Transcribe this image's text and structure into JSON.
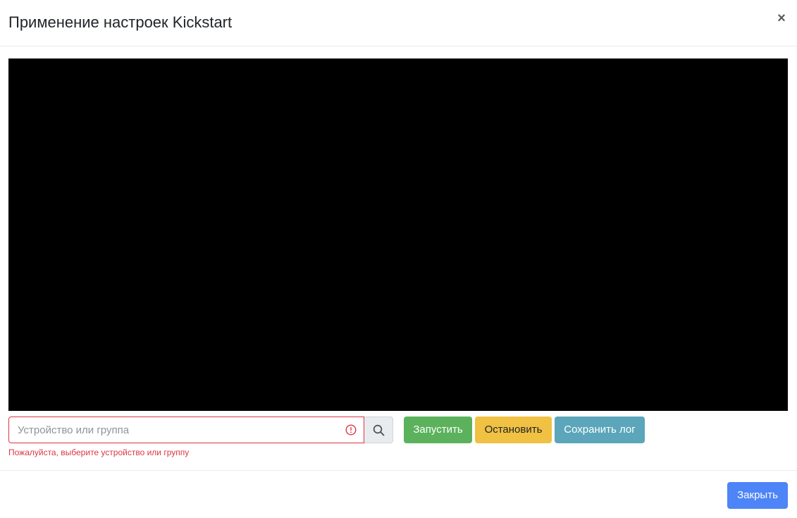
{
  "modal": {
    "title": "Применение настроек Kickstart",
    "close_icon": "×"
  },
  "terminal": {
    "background": "#000000"
  },
  "controls": {
    "device_input": {
      "value": "",
      "placeholder": "Устройство или группа",
      "error_icon": "exclamation-circle-icon",
      "error_message": "Пожалуйста, выберите устройство или группу"
    },
    "search_icon": "search-icon",
    "start_label": "Запустить",
    "stop_label": "Остановить",
    "save_log_label": "Сохранить лог"
  },
  "footer": {
    "close_label": "Закрыть"
  },
  "colors": {
    "danger": "#dc3545",
    "success": "#5cb25c",
    "warning": "#f0c142",
    "info": "#5ba6bb",
    "primary": "#4d84f7"
  }
}
